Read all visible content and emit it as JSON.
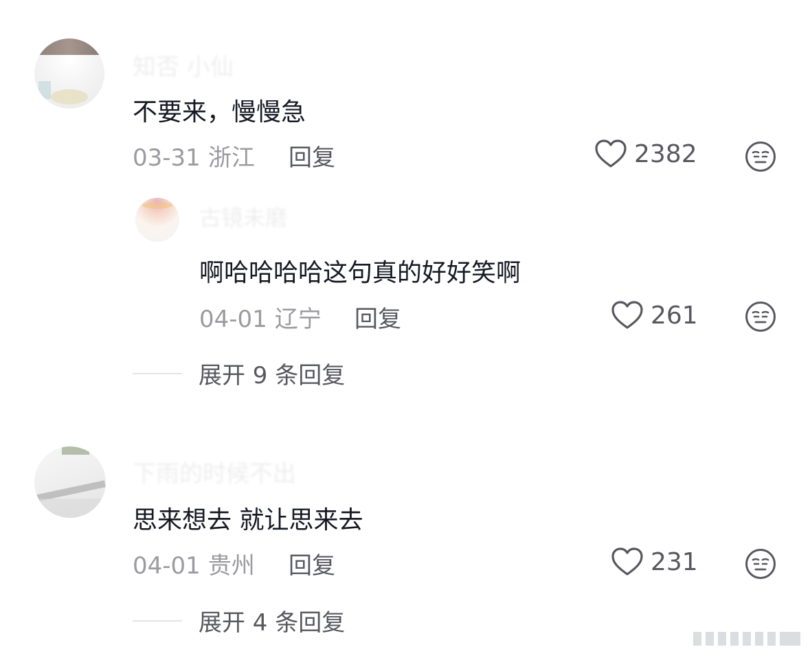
{
  "comments": [
    {
      "username": "知否 小仙",
      "text": "不要来，慢慢急",
      "date": "03-31",
      "location": "浙江",
      "reply_label": "回复",
      "likes": "2382",
      "replies": [
        {
          "username": "古镜未磨",
          "text": "啊哈哈哈哈这句真的好好笑啊",
          "date": "04-01",
          "location": "辽宁",
          "reply_label": "回复",
          "likes": "261"
        }
      ],
      "expand_label": "展开 9 条回复"
    },
    {
      "username": "下雨的时候不出",
      "text": "思来想去 就让思来去",
      "date": "04-01",
      "location": "贵州",
      "reply_label": "回复",
      "likes": "231",
      "expand_label": "展开 4 条回复"
    }
  ],
  "icons": {
    "like": "heart-outline-icon",
    "dislike": "neutral-face-icon"
  },
  "colors": {
    "text": "#161823",
    "meta": "#9a9aa0",
    "action": "#57585f"
  }
}
